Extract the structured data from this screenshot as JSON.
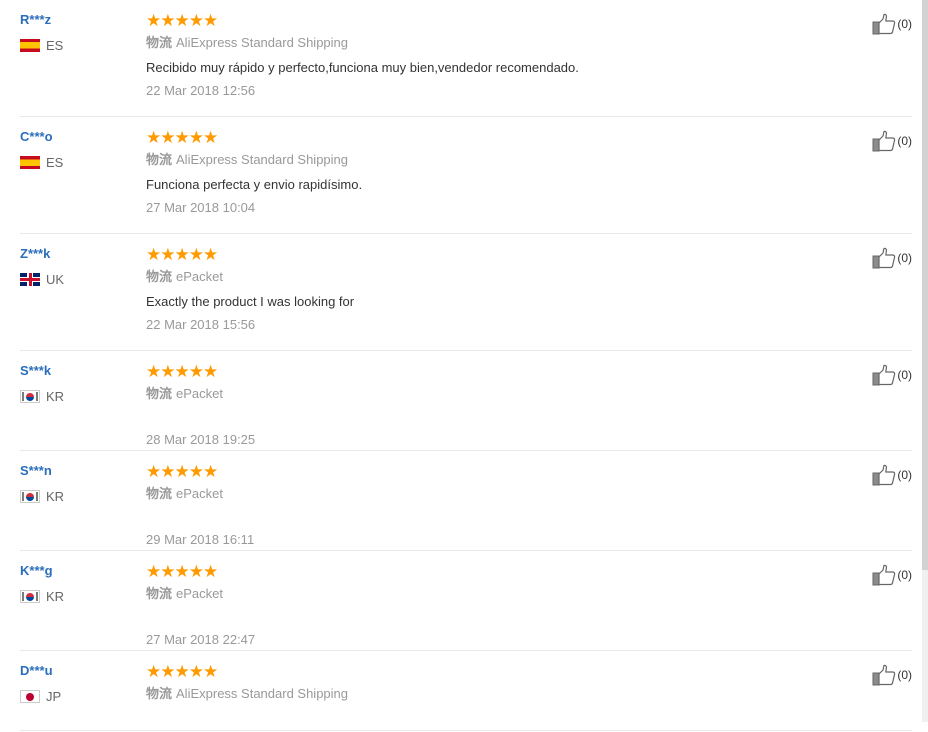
{
  "reviews": [
    {
      "user": "R***z",
      "country": "ES",
      "flag": "es",
      "rating": "★★★★★",
      "shipping_label": "物流",
      "shipping": "AliExpress Standard Shipping",
      "text": "Recibido muy rápido y perfecto,funciona muy bien,vendedor recomendado.",
      "date": "22 Mar 2018 12:56",
      "helpful": "(0)"
    },
    {
      "user": "C***o",
      "country": "ES",
      "flag": "es",
      "rating": "★★★★★",
      "shipping_label": "物流",
      "shipping": "AliExpress Standard Shipping",
      "text": "Funciona perfecta y envio rapidísimo.",
      "date": "27 Mar 2018 10:04",
      "helpful": "(0)"
    },
    {
      "user": "Z***k",
      "country": "UK",
      "flag": "uk",
      "rating": "★★★★★",
      "shipping_label": "物流",
      "shipping": "ePacket",
      "text": "Exactly the product I was looking for",
      "date": "22 Mar 2018 15:56",
      "helpful": "(0)"
    },
    {
      "user": "S***k",
      "country": "KR",
      "flag": "kr",
      "rating": "★★★★★",
      "shipping_label": "物流",
      "shipping": "ePacket",
      "text": "",
      "date": "28 Mar 2018 19:25",
      "helpful": "(0)"
    },
    {
      "user": "S***n",
      "country": "KR",
      "flag": "kr",
      "rating": "★★★★★",
      "shipping_label": "物流",
      "shipping": "ePacket",
      "text": "",
      "date": "29 Mar 2018 16:11",
      "helpful": "(0)"
    },
    {
      "user": "K***g",
      "country": "KR",
      "flag": "kr",
      "rating": "★★★★★",
      "shipping_label": "物流",
      "shipping": "ePacket",
      "text": "",
      "date": "27 Mar 2018 22:47",
      "helpful": "(0)"
    },
    {
      "user": "D***u",
      "country": "JP",
      "flag": "jp",
      "rating": "★★★★★",
      "shipping_label": "物流",
      "shipping": "AliExpress Standard Shipping",
      "text": "",
      "date": "",
      "helpful": "(0)"
    }
  ],
  "colors": {
    "username": "#2a6ebb",
    "star": "#ff9a00",
    "meta": "#999999"
  },
  "icons": {
    "helpful": "thumbs-up-icon"
  }
}
